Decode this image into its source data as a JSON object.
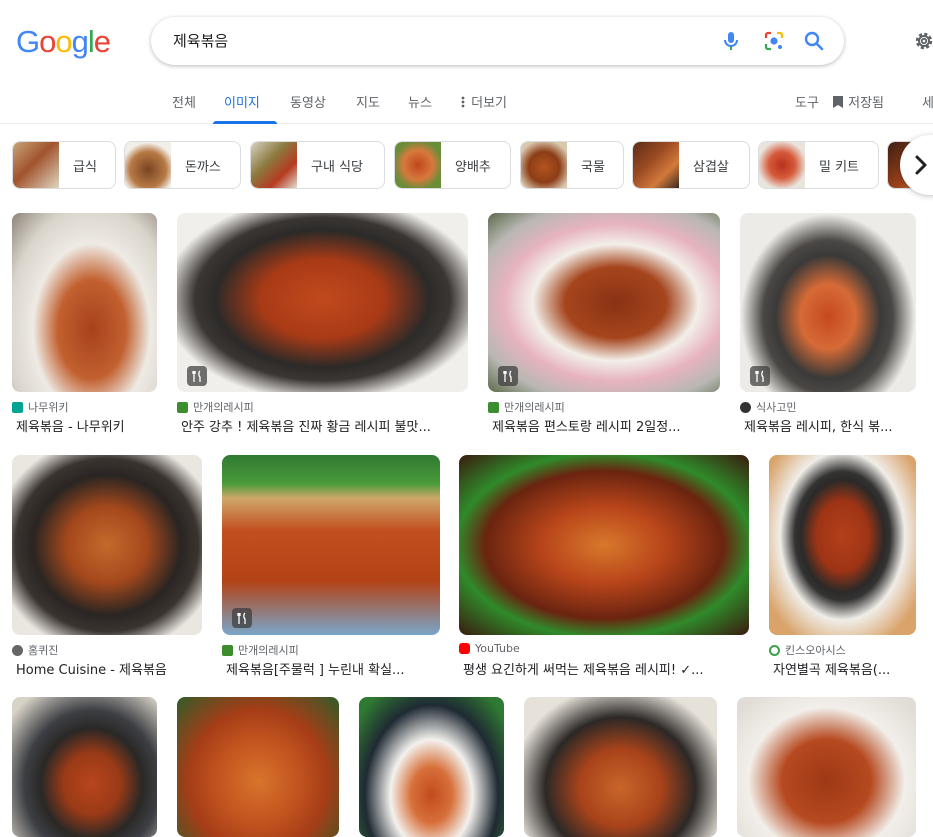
{
  "search": {
    "query": "제육볶음"
  },
  "tabs": [
    "전체",
    "이미지",
    "동영상",
    "지도",
    "뉴스",
    "더보기"
  ],
  "active_tab": "이미지",
  "right_tabs": {
    "tools": "도구",
    "saved": "저장됨",
    "safe": "세"
  },
  "chips": [
    "급식",
    "돈까스",
    "구내 식당",
    "양배추",
    "국물",
    "삼겹살",
    "밀 키트"
  ],
  "results": [
    {
      "source": "나무위키",
      "title": "제육볶음 - 나무위키"
    },
    {
      "source": "만개의레시피",
      "title": "안주 강추 ! 제육볶음 진짜 황금 레시피 불맛..."
    },
    {
      "source": "만개의레시피",
      "title": "제육볶음 편스토랑 레시피 2일정..."
    },
    {
      "source": "식사고민",
      "title": "제육볶음 레시피, 한식 볶..."
    },
    {
      "source": "홈퀴진",
      "title": "Home Cuisine - 제육볶음"
    },
    {
      "source": "만개의레시피",
      "title": "제육볶음[주물럭 ] 누린내 확실..."
    },
    {
      "source": "YouTube",
      "title": "평생 요긴하게 써먹는 제육볶음 레시피! ✓..."
    },
    {
      "source": "킨스오아시스",
      "title": "자연별곡 제육볶음(..."
    }
  ],
  "colors": {
    "accent": "#1a73e8",
    "g_blue": "#4285f4",
    "g_red": "#ea4335",
    "g_yellow": "#fbbc05",
    "g_green": "#34a853"
  },
  "icons": [
    "mic-icon",
    "lens-icon",
    "search-icon",
    "gear-icon",
    "bookmark-icon",
    "dots-icon",
    "chevron-right-icon",
    "recipe-icon"
  ]
}
